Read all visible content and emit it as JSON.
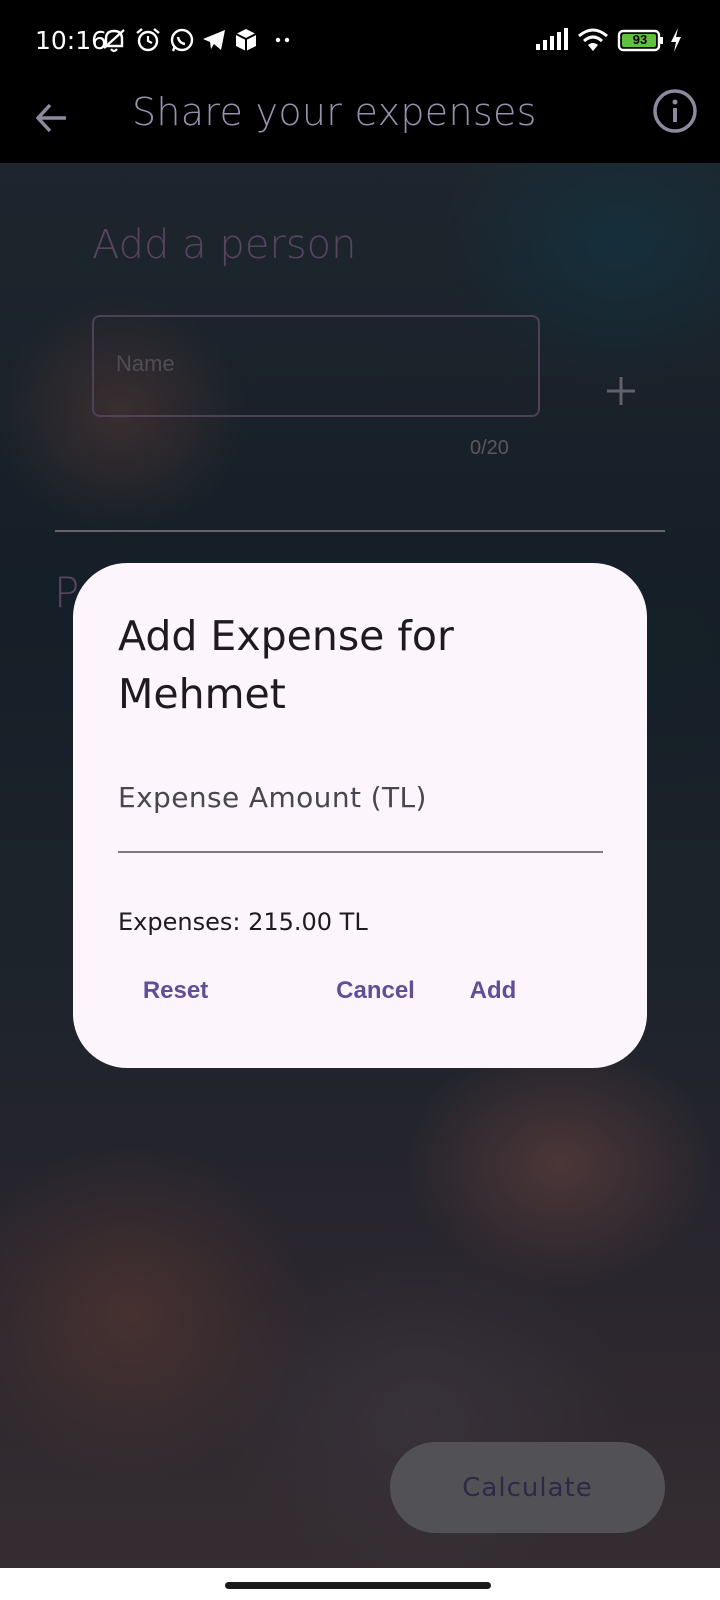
{
  "status_bar": {
    "time": "10:16",
    "battery": "93",
    "icons": [
      "bell-off-icon",
      "alarm-icon",
      "whatsapp-icon",
      "telegram-icon",
      "box-icon",
      "more-dots-icon",
      "signal-icon",
      "wifi-icon",
      "battery-icon",
      "charging-icon"
    ]
  },
  "app_bar": {
    "title": "Share your expenses",
    "back_icon": "arrow-back-icon",
    "info_icon": "info-icon"
  },
  "form": {
    "heading": "Add a person",
    "name_placeholder": "Name",
    "name_counter": "0/20",
    "add_icon": "plus-icon",
    "people_heading_partial": "P"
  },
  "dialog": {
    "title": "Add Expense for Mehmet",
    "amount_placeholder": "Expense Amount (TL)",
    "summary": "Expenses: 215.00 TL",
    "reset_label": "Reset",
    "cancel_label": "Cancel",
    "add_label": "Add"
  },
  "calculate_label": "Calculate",
  "colors": {
    "accent": "#5e4f97",
    "dialog_bg": "#fcf5fc",
    "heading_muted": "#7a5f86"
  }
}
